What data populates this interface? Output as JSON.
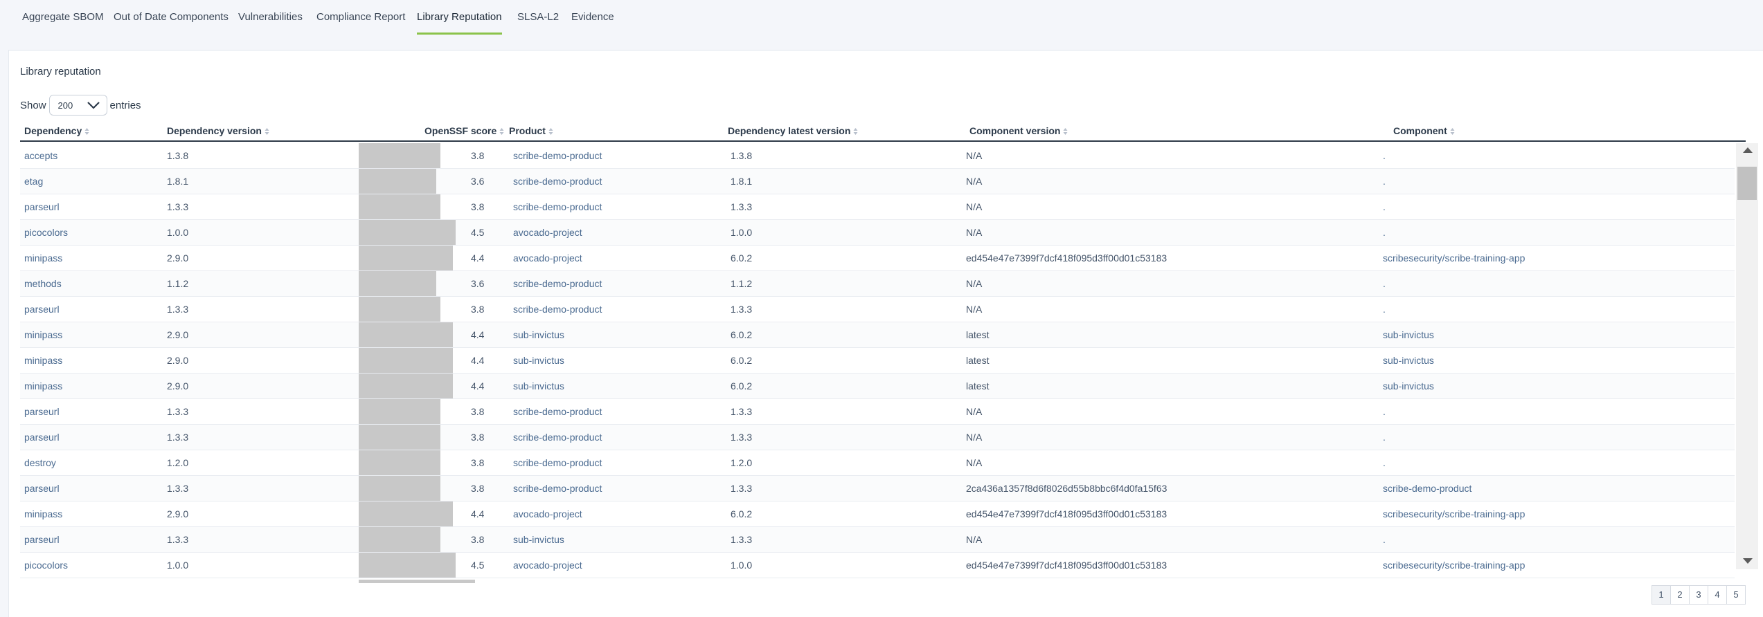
{
  "tabs": [
    {
      "label": "Aggregate SBOM",
      "active": false
    },
    {
      "label": "Out of Date Components",
      "active": false
    },
    {
      "label": "Vulnerabilities",
      "active": false
    },
    {
      "label": "Compliance Report",
      "active": false
    },
    {
      "label": "Library Reputation",
      "active": true
    },
    {
      "label": "SLSA-L2",
      "active": false
    },
    {
      "label": "Evidence",
      "active": false
    }
  ],
  "panel": {
    "title": "Library reputation",
    "show_label": "Show",
    "entries_value": "200",
    "entries_label": "entries"
  },
  "columns": {
    "dependency": "Dependency",
    "dependency_version": "Dependency version",
    "openssf_score": "OpenSSF score",
    "product": "Product",
    "latest_version": "Dependency latest version",
    "component_version": "Component version",
    "component": "Component"
  },
  "score_max": 10,
  "rows": [
    {
      "dependency": "accepts",
      "version": "1.3.8",
      "score": "3.8",
      "product": "scribe-demo-product",
      "latest": "1.3.8",
      "component_version": "N/A",
      "component": "."
    },
    {
      "dependency": "etag",
      "version": "1.8.1",
      "score": "3.6",
      "product": "scribe-demo-product",
      "latest": "1.8.1",
      "component_version": "N/A",
      "component": "."
    },
    {
      "dependency": "parseurl",
      "version": "1.3.3",
      "score": "3.8",
      "product": "scribe-demo-product",
      "latest": "1.3.3",
      "component_version": "N/A",
      "component": "."
    },
    {
      "dependency": "picocolors",
      "version": "1.0.0",
      "score": "4.5",
      "product": "avocado-project",
      "latest": "1.0.0",
      "component_version": "N/A",
      "component": "."
    },
    {
      "dependency": "minipass",
      "version": "2.9.0",
      "score": "4.4",
      "product": "avocado-project",
      "latest": "6.0.2",
      "component_version": "ed454e47e7399f7dcf418f095d3ff00d01c53183",
      "component": "scribesecurity/scribe-training-app"
    },
    {
      "dependency": "methods",
      "version": "1.1.2",
      "score": "3.6",
      "product": "scribe-demo-product",
      "latest": "1.1.2",
      "component_version": "N/A",
      "component": "."
    },
    {
      "dependency": "parseurl",
      "version": "1.3.3",
      "score": "3.8",
      "product": "scribe-demo-product",
      "latest": "1.3.3",
      "component_version": "N/A",
      "component": "."
    },
    {
      "dependency": "minipass",
      "version": "2.9.0",
      "score": "4.4",
      "product": "sub-invictus",
      "latest": "6.0.2",
      "component_version": "latest",
      "component": "sub-invictus"
    },
    {
      "dependency": "minipass",
      "version": "2.9.0",
      "score": "4.4",
      "product": "sub-invictus",
      "latest": "6.0.2",
      "component_version": "latest",
      "component": "sub-invictus"
    },
    {
      "dependency": "minipass",
      "version": "2.9.0",
      "score": "4.4",
      "product": "sub-invictus",
      "latest": "6.0.2",
      "component_version": "latest",
      "component": "sub-invictus"
    },
    {
      "dependency": "parseurl",
      "version": "1.3.3",
      "score": "3.8",
      "product": "scribe-demo-product",
      "latest": "1.3.3",
      "component_version": "N/A",
      "component": "."
    },
    {
      "dependency": "parseurl",
      "version": "1.3.3",
      "score": "3.8",
      "product": "scribe-demo-product",
      "latest": "1.3.3",
      "component_version": "N/A",
      "component": "."
    },
    {
      "dependency": "destroy",
      "version": "1.2.0",
      "score": "3.8",
      "product": "scribe-demo-product",
      "latest": "1.2.0",
      "component_version": "N/A",
      "component": "."
    },
    {
      "dependency": "parseurl",
      "version": "1.3.3",
      "score": "3.8",
      "product": "scribe-demo-product",
      "latest": "1.3.3",
      "component_version": "2ca436a1357f8d6f8026d55b8bbc6f4d0fa15f63",
      "component": "scribe-demo-product"
    },
    {
      "dependency": "minipass",
      "version": "2.9.0",
      "score": "4.4",
      "product": "avocado-project",
      "latest": "6.0.2",
      "component_version": "ed454e47e7399f7dcf418f095d3ff00d01c53183",
      "component": "scribesecurity/scribe-training-app"
    },
    {
      "dependency": "parseurl",
      "version": "1.3.3",
      "score": "3.8",
      "product": "sub-invictus",
      "latest": "1.3.3",
      "component_version": "N/A",
      "component": "."
    },
    {
      "dependency": "picocolors",
      "version": "1.0.0",
      "score": "4.5",
      "product": "avocado-project",
      "latest": "1.0.0",
      "component_version": "ed454e47e7399f7dcf418f095d3ff00d01c53183",
      "component": "scribesecurity/scribe-training-app"
    }
  ],
  "pagination": [
    "1",
    "2",
    "3",
    "4",
    "5"
  ],
  "current_page": "1"
}
